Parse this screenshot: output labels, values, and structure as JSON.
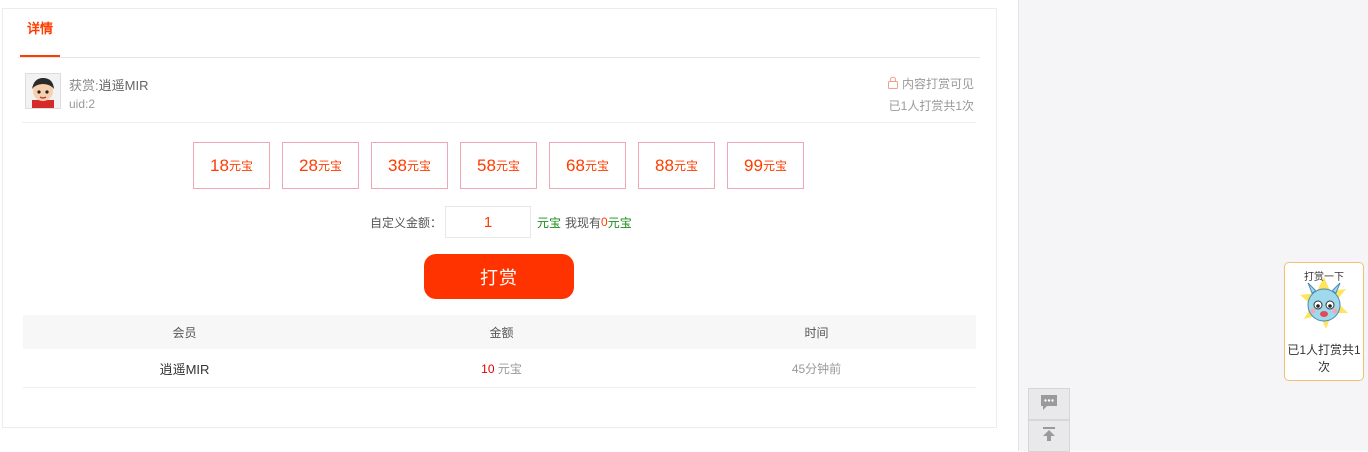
{
  "tabs": [
    {
      "label": "详情"
    }
  ],
  "author": {
    "prefix": "获赏:",
    "name": "逍遥MIR",
    "uid": "uid:2",
    "visibility": "内容打赏可见",
    "reward_count": "已1人打赏共1次"
  },
  "amounts": [
    {
      "value": "18",
      "unit": "元宝"
    },
    {
      "value": "28",
      "unit": "元宝"
    },
    {
      "value": "38",
      "unit": "元宝"
    },
    {
      "value": "58",
      "unit": "元宝"
    },
    {
      "value": "68",
      "unit": "元宝"
    },
    {
      "value": "88",
      "unit": "元宝"
    },
    {
      "value": "99",
      "unit": "元宝"
    }
  ],
  "custom": {
    "label": "自定义金额：",
    "value": "1",
    "unit": "元宝",
    "have_prefix": "我现有",
    "have_amount": "0",
    "have_unit": "元宝"
  },
  "reward_button": "打赏",
  "table": {
    "headers": [
      "会员",
      "金额",
      "时间"
    ],
    "rows": [
      {
        "member": "逍遥MIR",
        "amount": "10",
        "unit": "元宝",
        "time": "45分钟前"
      }
    ]
  },
  "float_widget": {
    "sticker_text": "打赏一下",
    "caption": "已1人打赏共1次"
  },
  "icons": {
    "lock": "lock-icon",
    "comment": "comment-icon",
    "back_to_top": "back-to-top-icon"
  },
  "colors": {
    "accent": "#ff3c00",
    "button": "#ff3300",
    "green": "#1a8a1a",
    "amount_border": "#f0a6b4"
  }
}
